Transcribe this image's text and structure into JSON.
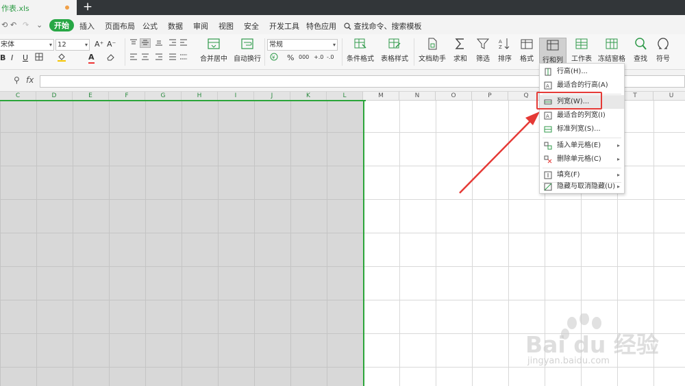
{
  "tab": {
    "filename": "作表.xls",
    "new_tab": "+"
  },
  "quick_access": {
    "open": "⟲",
    "undo": "↶",
    "redo": "↷",
    "more": "⌄"
  },
  "menu": {
    "items": [
      "开始",
      "插入",
      "页面布局",
      "公式",
      "数据",
      "审阅",
      "视图",
      "安全",
      "开发工具",
      "特色应用"
    ],
    "search": "查找命令、搜索模板"
  },
  "ribbon": {
    "font_name": "宋体",
    "font_size": "12",
    "grow_font": "A⁺",
    "shrink_font": "A⁻",
    "bold": "B",
    "italic": "I",
    "underline": "U",
    "font_color": "A",
    "number_format": "常规",
    "percent": "%",
    "thousands": "000",
    "dec_inc": "+.0",
    "dec_dec": "-.0",
    "merge_center": "合并居中",
    "wrap_text": "自动换行",
    "cond_format": "条件格式",
    "table_style": "表格样式",
    "doc_helper": "文档助手",
    "sum": "求和",
    "filter": "筛选",
    "sort": "排序",
    "format": "格式",
    "row_col": "行和列",
    "worksheet": "工作表",
    "freeze": "冻结窗格",
    "find": "查找",
    "symbol": "符号"
  },
  "formula_bar": {
    "zoom_icon": "⚲",
    "fx": "fx",
    "value": ""
  },
  "columns": [
    "C",
    "D",
    "E",
    "F",
    "G",
    "H",
    "I",
    "J",
    "K",
    "L",
    "M",
    "N",
    "O",
    "P",
    "Q",
    "R",
    "S",
    "T",
    "U"
  ],
  "dropdown": {
    "items": [
      {
        "label": "行高(H)...",
        "submenu": false
      },
      {
        "label": "最适合的行高(A)",
        "submenu": false
      },
      {
        "label": "列宽(W)...",
        "submenu": false
      },
      {
        "label": "最适合的列宽(I)",
        "submenu": false
      },
      {
        "label": "标准列宽(S)...",
        "submenu": false
      },
      {
        "label": "插入单元格(E)",
        "submenu": true
      },
      {
        "label": "删除单元格(C)",
        "submenu": true
      },
      {
        "label": "填充(F)",
        "submenu": true
      },
      {
        "label": "隐藏与取消隐藏(U)",
        "submenu": true
      }
    ],
    "highlighted_index": 2
  },
  "watermark": {
    "brand": "Bai du 经验",
    "url": "jingyan.baidu.com"
  },
  "colors": {
    "accent": "#27a745",
    "selection_border": "#2aa539",
    "highlight_red": "#e53935",
    "arrow_red": "#e53935"
  }
}
